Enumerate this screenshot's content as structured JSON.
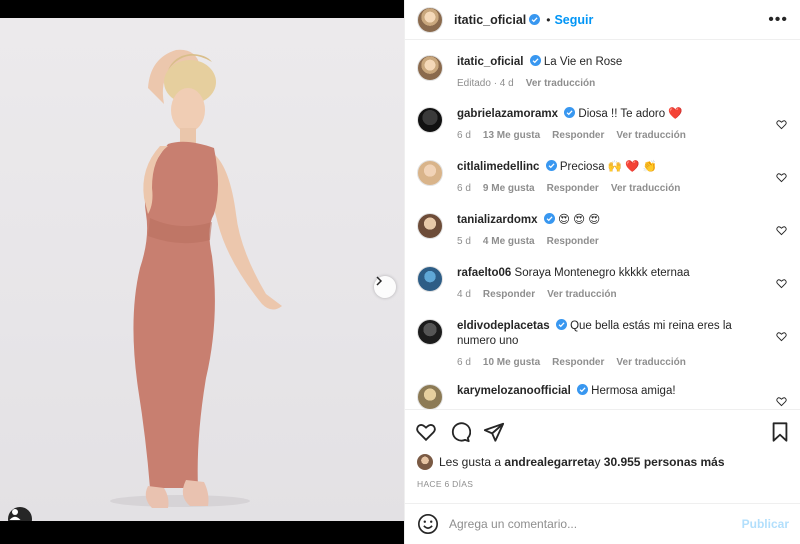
{
  "post": {
    "username": "itatic_oficial",
    "follow_label": "Seguir",
    "separator": "•",
    "more_label": "•••",
    "caption": {
      "username": "itatic_oficial",
      "text": "La Vie en Rose",
      "edited": "Editado · 4 d",
      "translate": "Ver traducción"
    }
  },
  "comments": [
    {
      "username": "gabrielazamoramx",
      "verified": true,
      "text": "Diosa !! Te adoro ❤️",
      "time": "6 d",
      "likes": "13 Me gusta",
      "reply": "Responder",
      "translate": "Ver traducción"
    },
    {
      "username": "citlalimedellinc",
      "verified": true,
      "text": "Preciosa 🙌 ❤️ 👏",
      "time": "6 d",
      "likes": "9 Me gusta",
      "reply": "Responder",
      "translate": "Ver traducción"
    },
    {
      "username": "tanializardomx",
      "verified": true,
      "text": "😍 😍 😍",
      "time": "5 d",
      "likes": "4 Me gusta",
      "reply": "Responder",
      "translate": ""
    },
    {
      "username": "rafaelto06",
      "verified": false,
      "text": "Soraya Montenegro kkkkk eternaa",
      "time": "4 d",
      "likes": "",
      "reply": "Responder",
      "translate": "Ver traducción"
    },
    {
      "username": "eldivodeplacetas",
      "verified": true,
      "text": "Que bella estás mi reina eres la numero uno",
      "time": "6 d",
      "likes": "10 Me gusta",
      "reply": "Responder",
      "translate": "Ver traducción"
    },
    {
      "username": "karymelozanoofficial",
      "verified": true,
      "text": "Hermosa amiga!",
      "time": "",
      "likes": "",
      "reply": "",
      "translate": ""
    }
  ],
  "likes_line": {
    "prefix": "Les gusta a ",
    "user": "andrealegarreta",
    "middle": " y ",
    "count": "30.955 personas más"
  },
  "timestamp": "HACE 6 DÍAS",
  "comment_box": {
    "placeholder": "Agrega un comentario...",
    "post_label": "Publicar"
  },
  "colors": {
    "accent": "#0095f6",
    "verified": "#3897f0",
    "post_disabled": "#b2dffc",
    "muted": "#8e8e8e"
  },
  "icons": [
    "verified-badge-icon",
    "heart-icon",
    "comment-icon",
    "share-icon",
    "bookmark-icon",
    "emoji-icon",
    "chevron-right-icon",
    "user-tag-icon",
    "more-options-icon"
  ]
}
